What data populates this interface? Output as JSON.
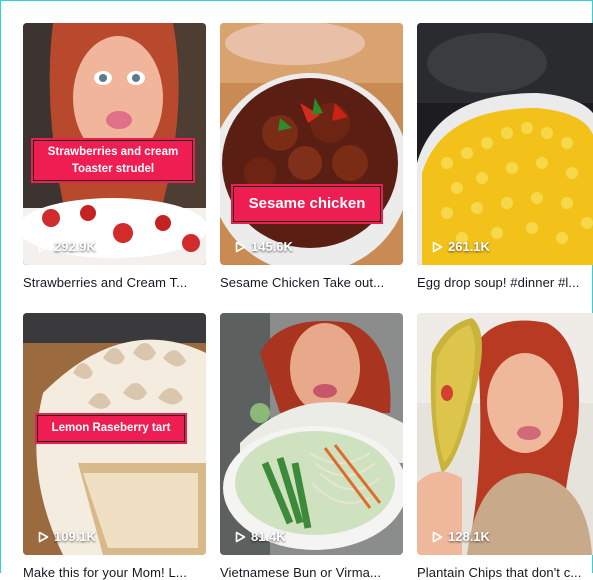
{
  "videos": [
    {
      "views": "292.9K",
      "caption": "Strawberries and Cream T...",
      "overlay_line1": "Strawberries and cream",
      "overlay_line2": "Toaster strudel"
    },
    {
      "views": "145.6K",
      "caption": "Sesame Chicken Take out...",
      "overlay": "Sesame chicken"
    },
    {
      "views": "261.1K",
      "caption": "Egg drop soup! #dinner #l..."
    },
    {
      "views": "109.1K",
      "caption": "Make this for your Mom! L...",
      "overlay": "Lemon Raseberry tart"
    },
    {
      "views": "81.4K",
      "caption": "Vietnamese Bun or Virma..."
    },
    {
      "views": "128.1K",
      "caption": "Plantain Chips that don't c..."
    }
  ],
  "colors": {
    "frame_border": "#2ed3d6",
    "overlay_bg": "#ee1d52",
    "caption_text": "#161823"
  },
  "icons": {
    "views": "play-icon"
  }
}
